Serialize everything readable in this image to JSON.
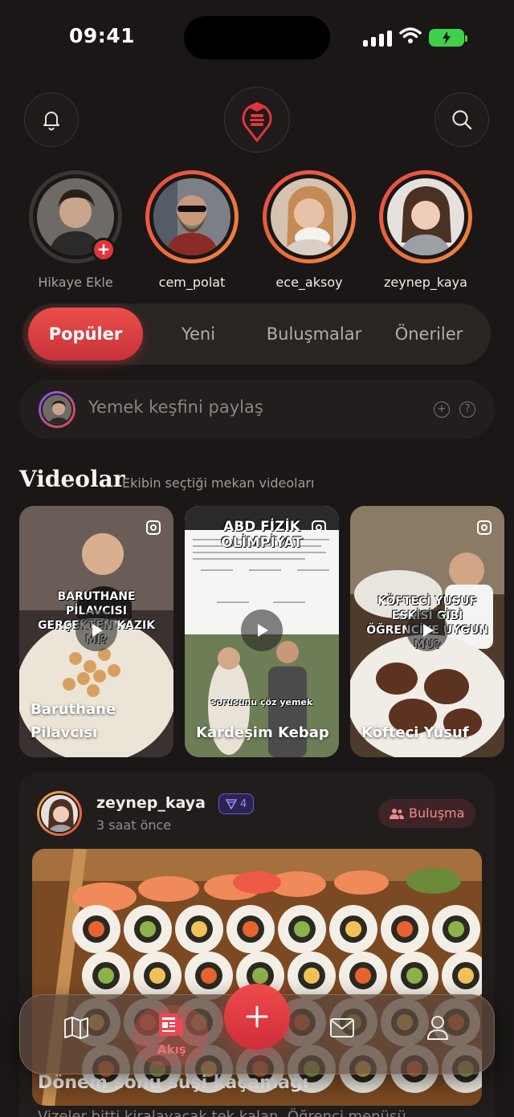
{
  "status": {
    "time": "09:41"
  },
  "stories": [
    {
      "name": "Hikaye Ekle"
    },
    {
      "name": "cem_polat"
    },
    {
      "name": "ece_aksoy"
    },
    {
      "name": "zeynep_kaya"
    }
  ],
  "tabs": [
    {
      "label": "Popüler",
      "active": true
    },
    {
      "label": "Yeni"
    },
    {
      "label": "Buluşmalar"
    },
    {
      "label": "Öneriler"
    }
  ],
  "composer": {
    "placeholder": "Yemek keşfini paylaş"
  },
  "videos": {
    "title": "Videolar",
    "subtitle": "Ekibin seçtiği mekan videoları",
    "items": [
      {
        "title_line1": "Baruthane",
        "title_line2": "Pilavcısı",
        "caption": "BARUTHANE PİLAVCISI GERÇEKTEN KAZIK MI?"
      },
      {
        "title_line1": "Kardeşim Kebap",
        "caption": "ABD FİZİK OLİMPİYAT",
        "caption2": "sorusunu çöz yemek"
      },
      {
        "title_line1": "Köfteci Yusuf",
        "caption": "KÖFTECİ YUSUF ESKİSİ GİBİ ÖĞRENCİYE UYGUN MU?"
      }
    ]
  },
  "post": {
    "user": "zeynep_kaya",
    "badge": "4",
    "time": "3 saat önce",
    "tag": "Buluşma",
    "title": "Dönem sonu suşi kaçamağı",
    "snippet": "Vizeler bitti kiralayacak tek kalan. Öğrenci menüsü..."
  },
  "nav": {
    "feed_label": "Akış"
  },
  "colors": {
    "accent": "#e2343f",
    "background": "#1a1716"
  }
}
